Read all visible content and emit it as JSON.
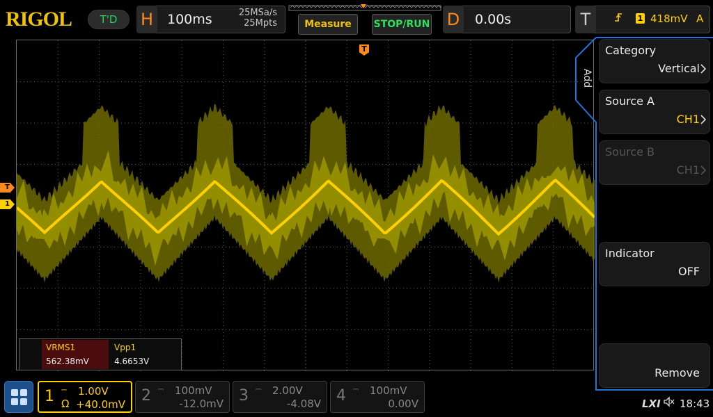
{
  "brand": {
    "logo_text": "RIGOL",
    "mode_badge": "T'D"
  },
  "horizontal": {
    "letter": "H",
    "timebase": "100ms",
    "sample_rate": "25MSa/s",
    "memory_depth": "25Mpts"
  },
  "toolbar": {
    "measure_label": "Measure",
    "stop_run_label": "STOP/RUN"
  },
  "delay": {
    "letter": "D",
    "value": "0.00s"
  },
  "trigger": {
    "letter": "T",
    "channel_badge": "1",
    "level": "418mV",
    "mode": "A",
    "marker": "T"
  },
  "markers": {
    "trigger_level": "T",
    "channel1": "1"
  },
  "measurements": [
    {
      "name": "VRMS1",
      "value": "562.38mV"
    },
    {
      "name": "Vpp1",
      "value": "4.6653V"
    }
  ],
  "menu": {
    "tab_label": "Add",
    "items": [
      {
        "label": "Category",
        "value": "Vertical",
        "enabled": true
      },
      {
        "label": "Source A",
        "value": "CH1",
        "enabled": true
      },
      {
        "label": "Source B",
        "value": "CH1",
        "enabled": false
      },
      {
        "label": "Indicator",
        "value": "OFF",
        "enabled": true
      },
      {
        "label": "",
        "value": "Remove",
        "enabled": true
      }
    ]
  },
  "channels": [
    {
      "number": "1",
      "scale": "1.00V",
      "offset": "+40.0mV",
      "impedance": "Ω",
      "active": true
    },
    {
      "number": "2",
      "scale": "100mV",
      "offset": "-12.0mV",
      "active": false
    },
    {
      "number": "3",
      "scale": "2.00V",
      "offset": "-4.08V",
      "active": false
    },
    {
      "number": "4",
      "scale": "100mV",
      "offset": "0.00V",
      "active": false
    }
  ],
  "status": {
    "lxi": "LXI",
    "time": "18:43"
  },
  "colors": {
    "ch1": "#ffd000",
    "trigger": "#ff8a1c",
    "menu_border": "#1e73d8",
    "measure_active": "#4a0c0c"
  }
}
